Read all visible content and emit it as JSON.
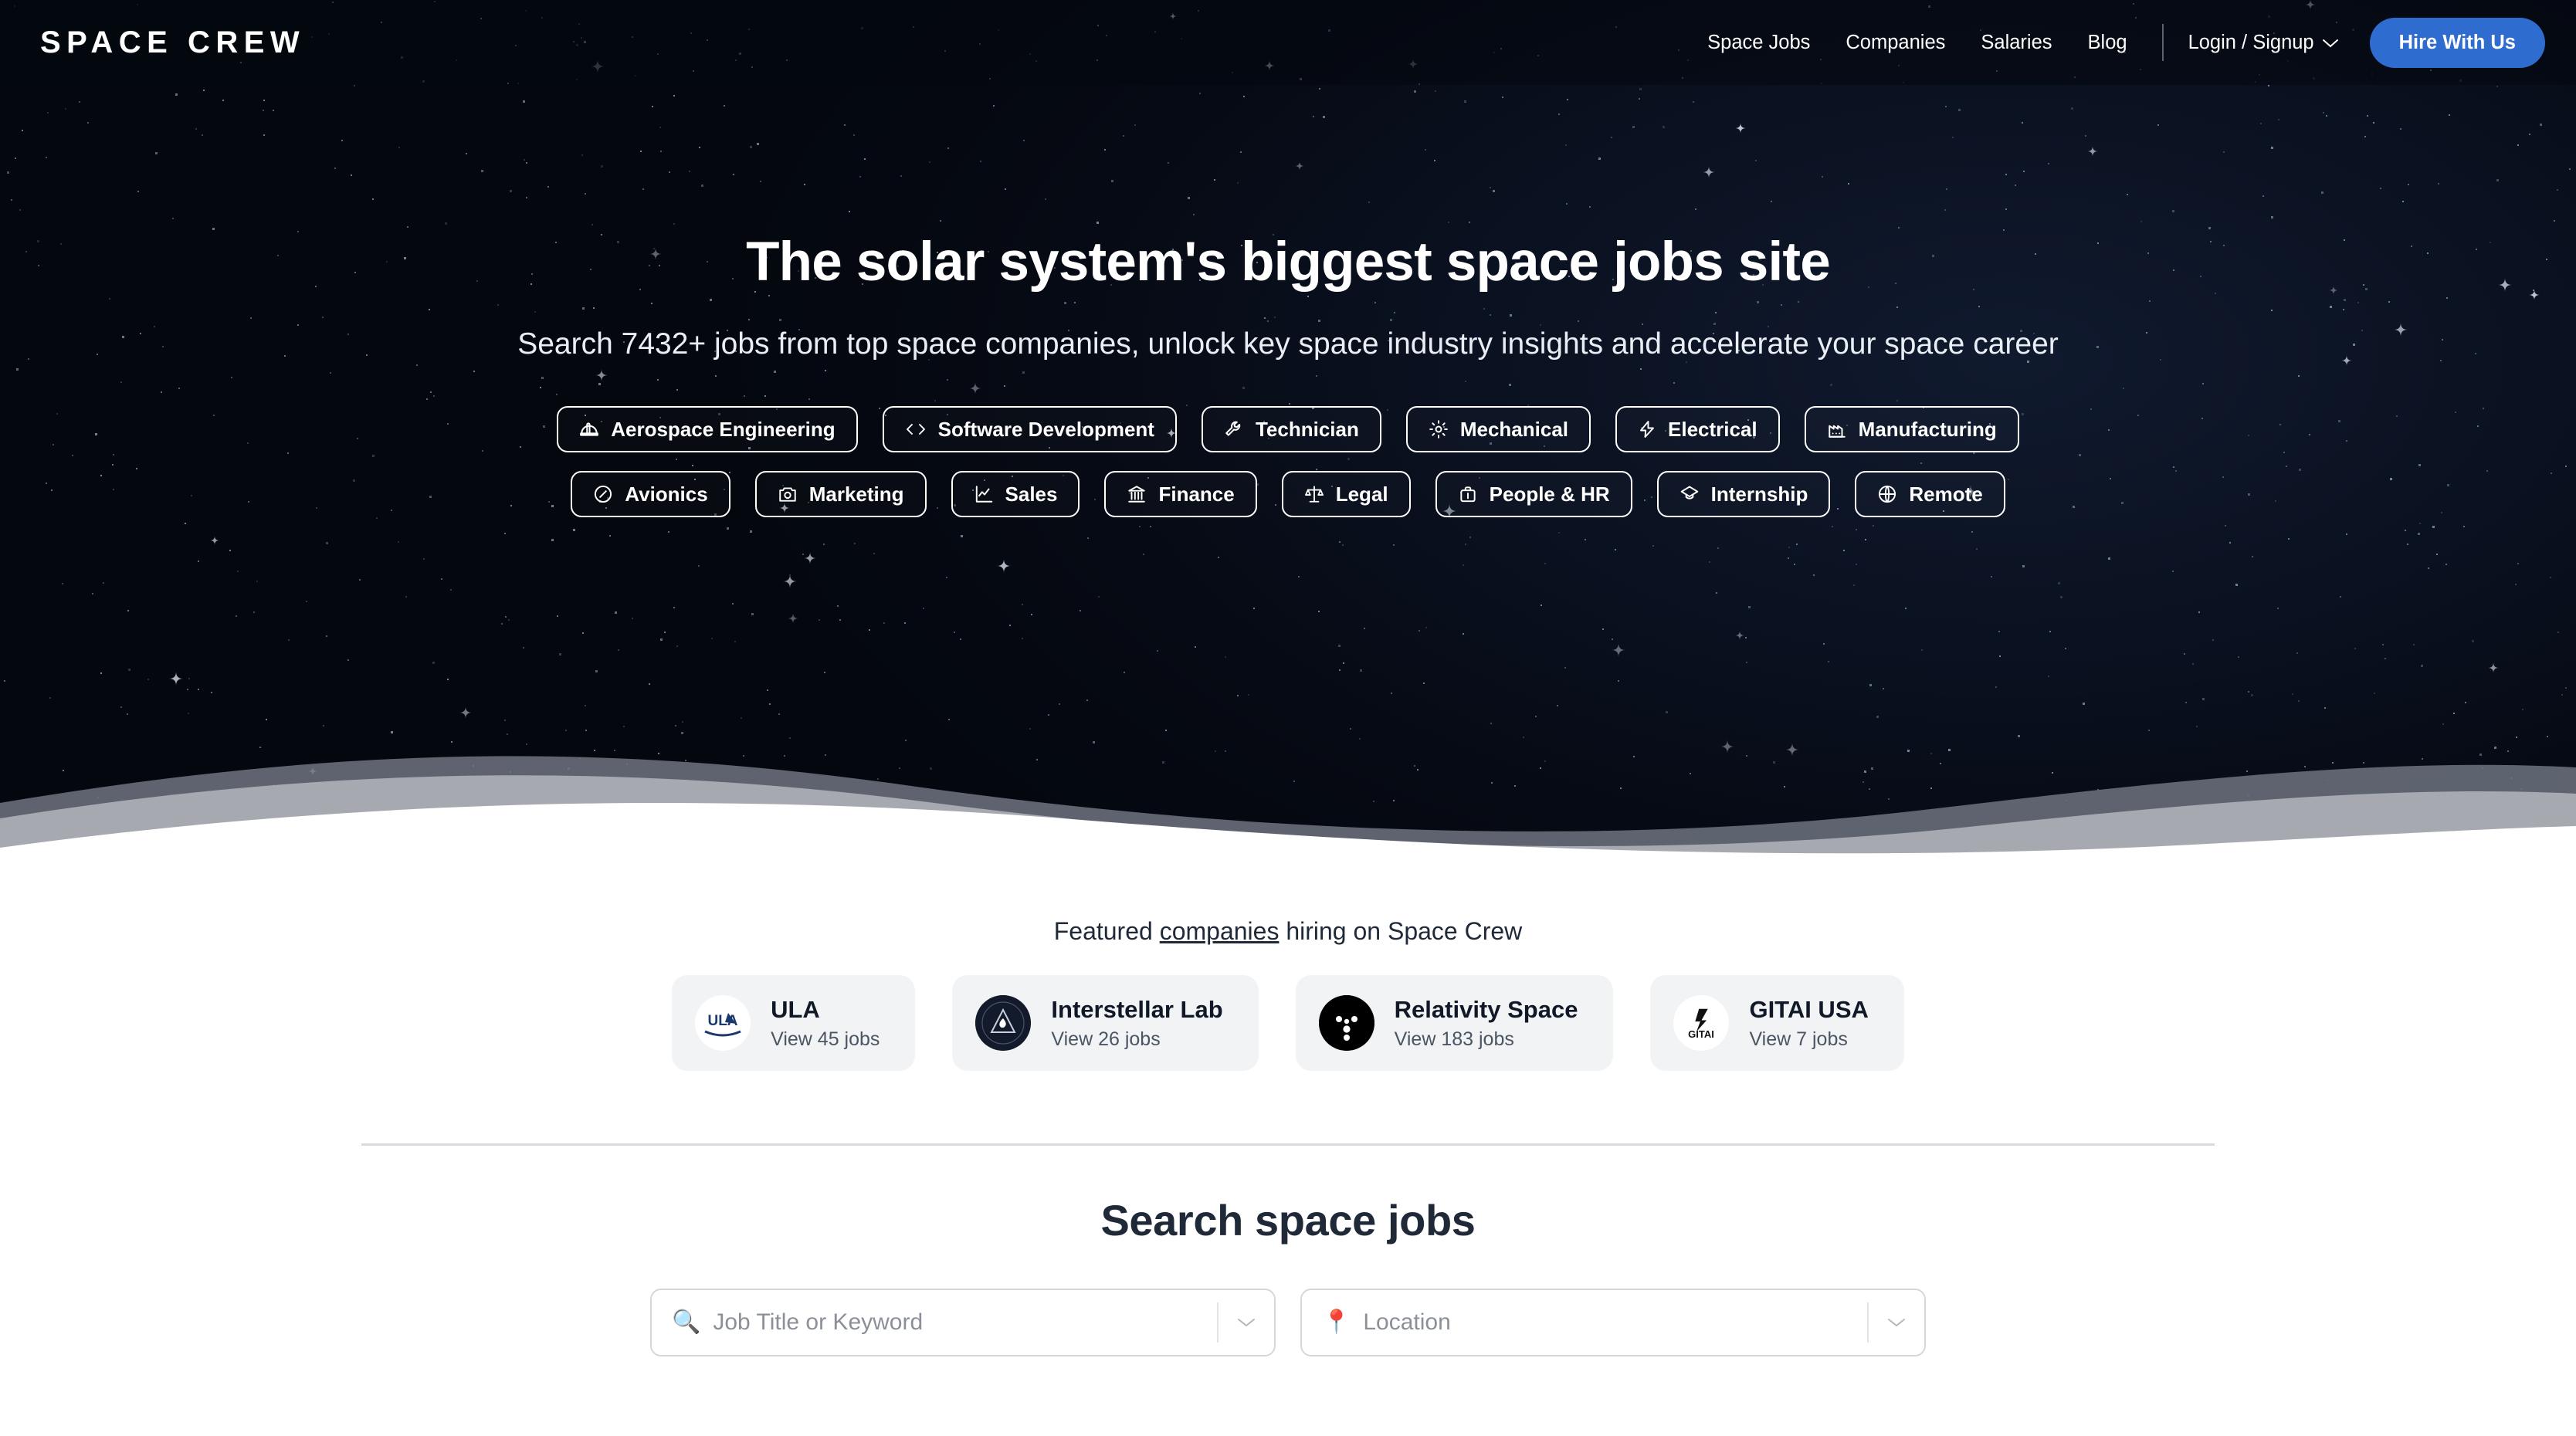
{
  "brand": {
    "logo": "SPACE CREW"
  },
  "nav": {
    "links": [
      {
        "label": "Space Jobs"
      },
      {
        "label": "Companies"
      },
      {
        "label": "Salaries"
      },
      {
        "label": "Blog"
      }
    ],
    "login_label": "Login / Signup",
    "login_caret": "⌄",
    "cta_label": "Hire With Us",
    "cta_color": "#2f6cd0"
  },
  "hero": {
    "headline": "The solar system's biggest space jobs site",
    "subheadline": "Search 7432+ jobs from top space companies, unlock key space industry insights and accelerate your space career",
    "job_count": "7432+",
    "categories_row1": [
      {
        "label": "Aerospace Engineering",
        "icon": "hard-hat-icon"
      },
      {
        "label": "Software Development",
        "icon": "code-brackets-icon"
      },
      {
        "label": "Technician",
        "icon": "wrench-icon"
      },
      {
        "label": "Mechanical",
        "icon": "gear-icon"
      },
      {
        "label": "Electrical",
        "icon": "lightning-bolt-icon"
      },
      {
        "label": "Manufacturing",
        "icon": "factory-icon"
      }
    ],
    "categories_row2": [
      {
        "label": "Avionics",
        "icon": "compass-icon"
      },
      {
        "label": "Marketing",
        "icon": "camera-icon"
      },
      {
        "label": "Sales",
        "icon": "line-chart-icon"
      },
      {
        "label": "Finance",
        "icon": "bank-icon"
      },
      {
        "label": "Legal",
        "icon": "scales-icon"
      },
      {
        "label": "People & HR",
        "icon": "briefcase-icon"
      },
      {
        "label": "Internship",
        "icon": "graduation-cap-icon"
      },
      {
        "label": "Remote",
        "icon": "globe-icon"
      }
    ]
  },
  "featured": {
    "title_prefix": "Featured ",
    "title_link": "companies",
    "title_suffix": " hiring on Space Crew",
    "companies": [
      {
        "name": "ULA",
        "jobs": "View 45 jobs",
        "logo": "ula-logo"
      },
      {
        "name": "Interstellar Lab",
        "jobs": "View 26 jobs",
        "logo": "interstellar-lab-logo"
      },
      {
        "name": "Relativity Space",
        "jobs": "View 183 jobs",
        "logo": "relativity-space-logo"
      },
      {
        "name": "GITAI USA",
        "jobs": "View 7 jobs",
        "logo": "gitai-usa-logo"
      }
    ]
  },
  "search": {
    "title": "Search space jobs",
    "keyword_placeholder": "Job Title or Keyword",
    "keyword_value": "",
    "keyword_icon": "🔍",
    "location_placeholder": "Location",
    "location_value": "",
    "location_icon": "📍",
    "caret": "⌄"
  }
}
